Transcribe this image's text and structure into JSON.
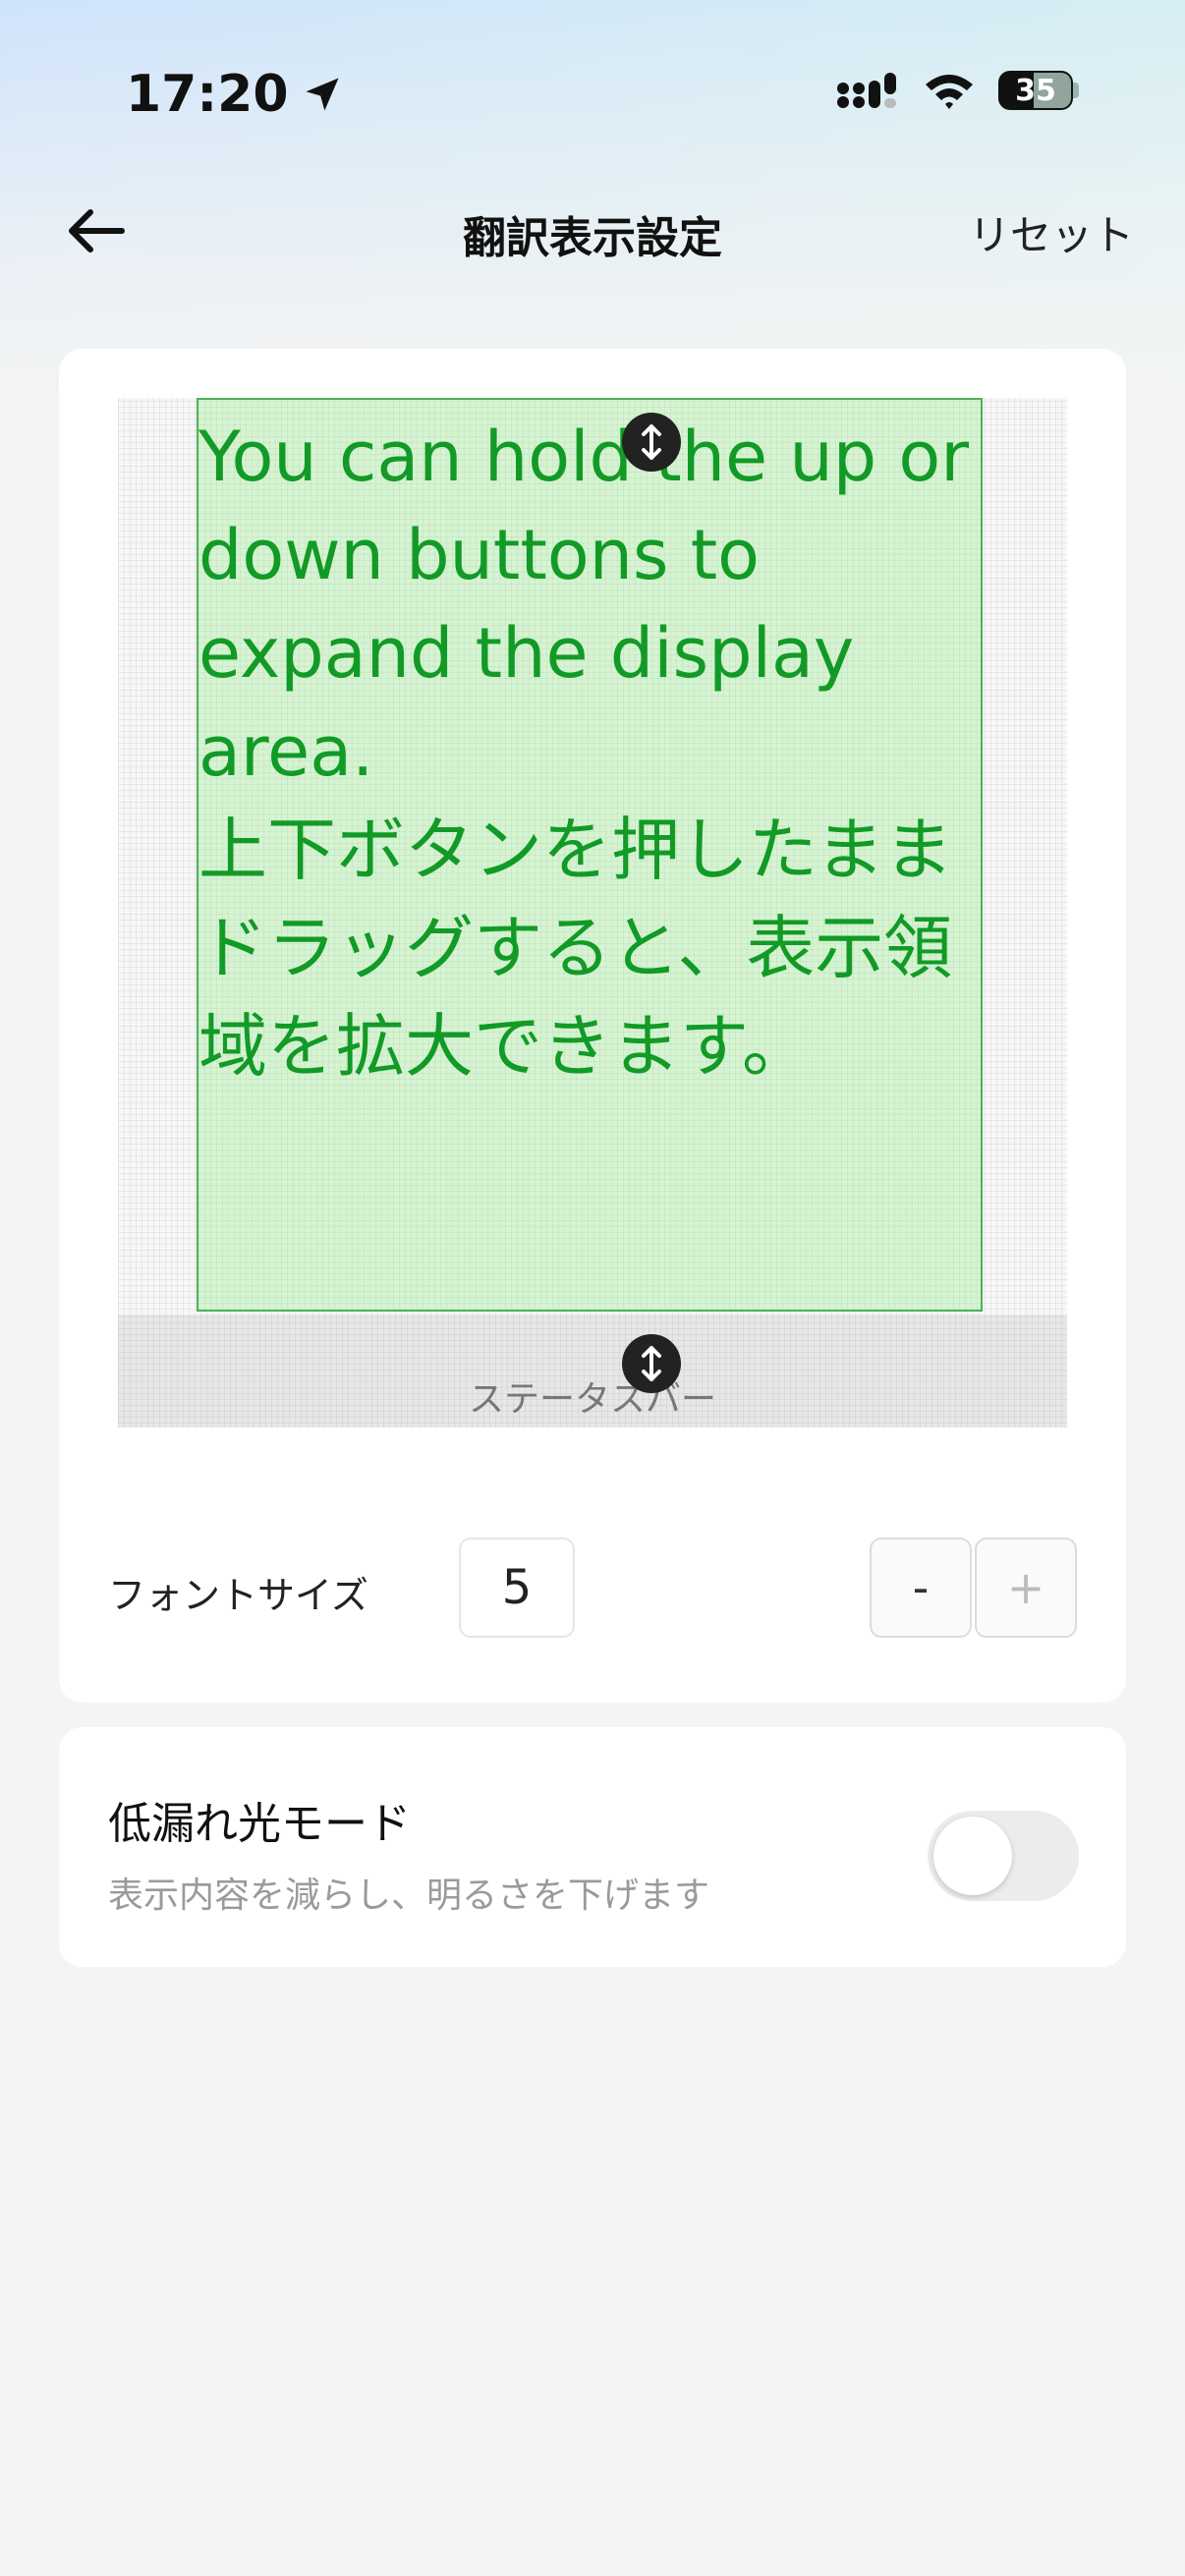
{
  "status_bar": {
    "time": "17:20",
    "battery": "35"
  },
  "nav": {
    "title": "翻訳表示設定",
    "reset_label": "リセット"
  },
  "preview": {
    "display_text": "You can hold the up or down buttons to expand the display area.\n上下ボタンを押したままドラッグすると、表示領域を拡大できます。",
    "status_bar_label": "ステータスバー"
  },
  "font_size": {
    "label": "フォントサイズ",
    "value": "5",
    "minus_label": "-",
    "plus_label": "+"
  },
  "low_leak": {
    "title": "低漏れ光モード",
    "description": "表示内容を減らし、明るさを下げます",
    "enabled": false
  },
  "colors": {
    "accent_green": "#129a26",
    "display_bg": "#d6f3d2"
  }
}
